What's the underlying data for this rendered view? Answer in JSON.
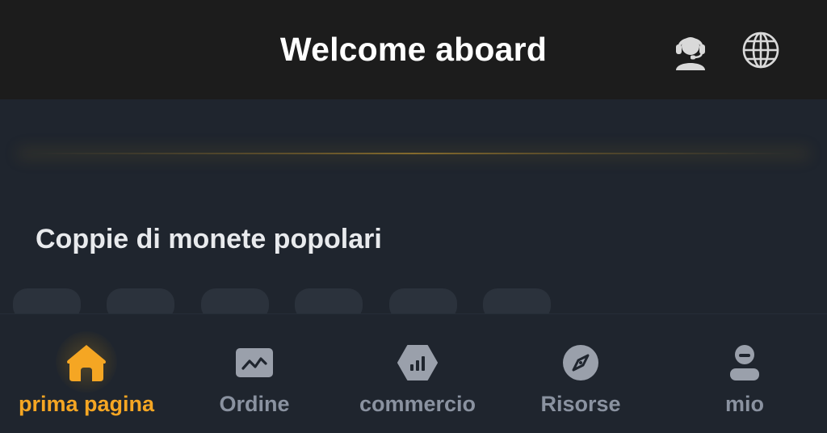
{
  "header": {
    "title": "Welcome aboard",
    "icons": [
      "headset-support-icon",
      "globe-icon"
    ]
  },
  "main": {
    "section_title": "Coppie di monete popolari",
    "accent_color": "#f5a623"
  },
  "bottom_nav": {
    "items": [
      {
        "label": "prima pagina",
        "icon": "home-icon",
        "active": true
      },
      {
        "label": "Ordine",
        "icon": "chart-icon",
        "active": false
      },
      {
        "label": "commercio",
        "icon": "trade-icon",
        "active": false
      },
      {
        "label": "Risorse",
        "icon": "compass-icon",
        "active": false
      },
      {
        "label": "mio",
        "icon": "profile-icon",
        "active": false
      }
    ]
  }
}
